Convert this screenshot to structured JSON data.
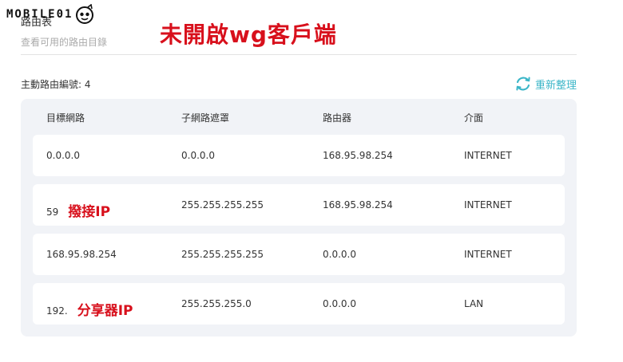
{
  "watermark": {
    "text": "MOBILE01"
  },
  "header": {
    "title": "路由表",
    "subtitle": "查看可用的路由目錄",
    "annotation": "未開啟wg客戶端"
  },
  "toolbar": {
    "route_count": "主動路由編號: 4",
    "refresh_label": "重新整理"
  },
  "table": {
    "columns": [
      "目標網路",
      "子網路遮罩",
      "路由器",
      "介面"
    ],
    "rows": [
      {
        "dest": "0.0.0.0",
        "note": "",
        "mask": "0.0.0.0",
        "gateway": "168.95.98.254",
        "iface": "INTERNET"
      },
      {
        "dest": "59",
        "note": "撥接IP",
        "mask": "255.255.255.255",
        "gateway": "168.95.98.254",
        "iface": "INTERNET"
      },
      {
        "dest": "168.95.98.254",
        "note": "",
        "mask": "255.255.255.255",
        "gateway": "0.0.0.0",
        "iface": "INTERNET"
      },
      {
        "dest": "192.",
        "note": "分享器IP",
        "mask": "255.255.255.0",
        "gateway": "0.0.0.0",
        "iface": "LAN"
      }
    ]
  },
  "colors": {
    "accent": "#3bb6c8",
    "annotation": "#d8101c",
    "panel": "#f1f3f7"
  },
  "icons": {
    "refresh": "refresh-icon",
    "mascot": "mascot-icon"
  }
}
